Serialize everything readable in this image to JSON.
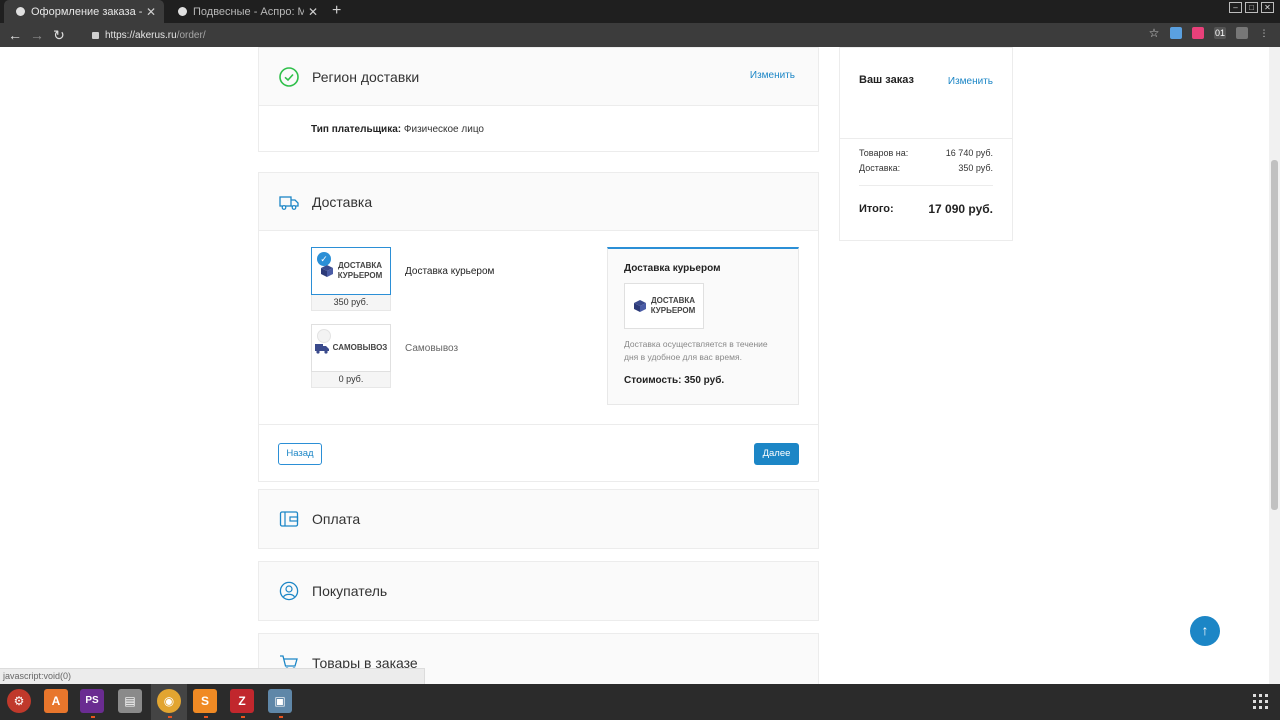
{
  "browser": {
    "tabs": [
      {
        "title": "Оформление заказа - Ас",
        "active": true
      },
      {
        "title": "Подвесные - Аспро: Мар",
        "active": false
      }
    ],
    "url_host": "https://akerus.ru",
    "url_path": "/order/"
  },
  "region": {
    "title": "Регион доставки",
    "change_label": "Изменить",
    "payer_label": "Тип плательщика:",
    "payer_value": "Физическое лицо"
  },
  "delivery": {
    "title": "Доставка",
    "options": [
      {
        "name": "Доставка курьером",
        "price": "350 руб.",
        "logo_line1": "ДОСТАВКА",
        "logo_line2": "КУРЬЕРОМ",
        "selected": true
      },
      {
        "name": "Самовывоз",
        "price": "0 руб.",
        "logo_line1": "САМОВЫВОЗ",
        "selected": false
      }
    ],
    "detail": {
      "title": "Доставка курьером",
      "logo_line1": "ДОСТАВКА",
      "logo_line2": "КУРЬЕРОМ",
      "description": "Доставка осуществляется в течение дня в удобное для вас время.",
      "cost": "Стоимость: 350 руб."
    },
    "back_label": "Назад",
    "next_label": "Далее"
  },
  "payment": {
    "title": "Оплата"
  },
  "buyer": {
    "title": "Покупатель"
  },
  "goods": {
    "title": "Товары в заказе"
  },
  "summary": {
    "title": "Ваш заказ",
    "change_label": "Изменить",
    "goods_label": "Товаров на:",
    "goods_value": "16 740 руб.",
    "delivery_label": "Доставка:",
    "delivery_value": "350 руб.",
    "total_label": "Итого:",
    "total_value": "17 090 руб."
  },
  "status_bar": "javascript:void(0)",
  "colors": {
    "accent": "#1c86c6",
    "success": "#2fbf4a"
  }
}
